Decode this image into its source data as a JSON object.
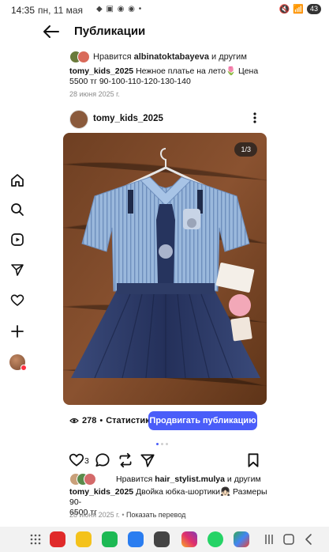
{
  "status": {
    "time": "14:35",
    "date": "пн, 11 мая",
    "notif_icons": "◆ ▣ ◉ ◉ •",
    "battery": "43"
  },
  "header": {
    "title": "Публикации"
  },
  "post1": {
    "liked_prefix": "Нравится",
    "liked_user": "albinatoktabayeva",
    "liked_suffix": "и другим",
    "caption_user": "tomy_kids_2025",
    "caption_text": "Нежное платье на лето🌷 Цена 5500 тг 90-100-110-120-130-140",
    "date": "28 июня 2025 г."
  },
  "post2": {
    "author": "tomy_kids_2025",
    "image_counter": "1/3",
    "views": "278",
    "stats_label": "Статистика",
    "promote_label": "Продвигать публикацию",
    "like_count": "3",
    "liked_prefix": "Нравится",
    "liked_user": "hair_stylist.mulya",
    "liked_suffix": "и другим",
    "caption_user": "tomy_kids_2025",
    "caption_text": "Двойка  юбка-шортики👧🏻 Размеры 90-",
    "caption_text2": "6500 тг",
    "date": "28 июня 2025 г.",
    "translate": "Показать перевод"
  },
  "colors": {
    "accent": "#4a5df9",
    "table": "#7a4a2a",
    "shirt": "#8fb0d8",
    "skirt": "#2e3c66"
  }
}
